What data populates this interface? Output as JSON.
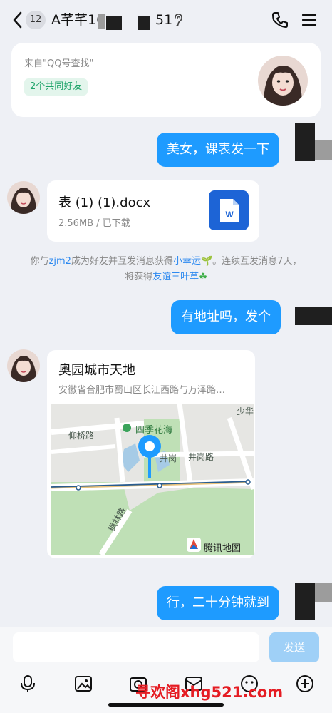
{
  "header": {
    "unread_count": "12",
    "title": "A芊芊16",
    "title_suffix": "51",
    "icons": [
      "back-icon",
      "ear-icon",
      "phone-icon",
      "menu-icon"
    ]
  },
  "profile_card": {
    "source": "来自\"QQ号查找\"",
    "mutual_friends": "2个共同好友"
  },
  "messages": {
    "out_1": "美女，课表发一下",
    "file": {
      "name": "表 (1) (1).docx",
      "meta": "2.56MB / 已下载",
      "icon": "word-doc-icon",
      "icon_letter": "W"
    },
    "notice": {
      "part1": "你与",
      "user": "zjm2",
      "part2": "成为好友并互发消息获得",
      "item1": "小幸运",
      "part3": "。连续互发消息7天，",
      "part4": "将获得",
      "item2": "友谊三叶草"
    },
    "out_2": "有地址吗，发个",
    "location": {
      "title": "奥园城市天地",
      "address": "安徽省合肥市蜀山区长江西路与万泽路…",
      "map_labels": {
        "park": "四季花海",
        "road1": "仰桥路",
        "road2": "井岗路",
        "road3": "井岗",
        "road4": "枫林路",
        "corner": "少华",
        "provider": "腾讯地图"
      }
    },
    "out_3": "行，二十分钟就到"
  },
  "input_bar": {
    "placeholder": "",
    "send_label": "发送",
    "tools": [
      "mic-icon",
      "image-icon",
      "camera-icon",
      "gift-icon",
      "emoji-icon",
      "plus-icon"
    ]
  },
  "watermark": "寻欢阁xhg521.com",
  "colors": {
    "accent": "#1e9bff",
    "background": "#eef0f5",
    "send_disabled": "#9fd0f7",
    "highlight_link": "#2e8af0",
    "mutual_green": "#20a46b"
  }
}
